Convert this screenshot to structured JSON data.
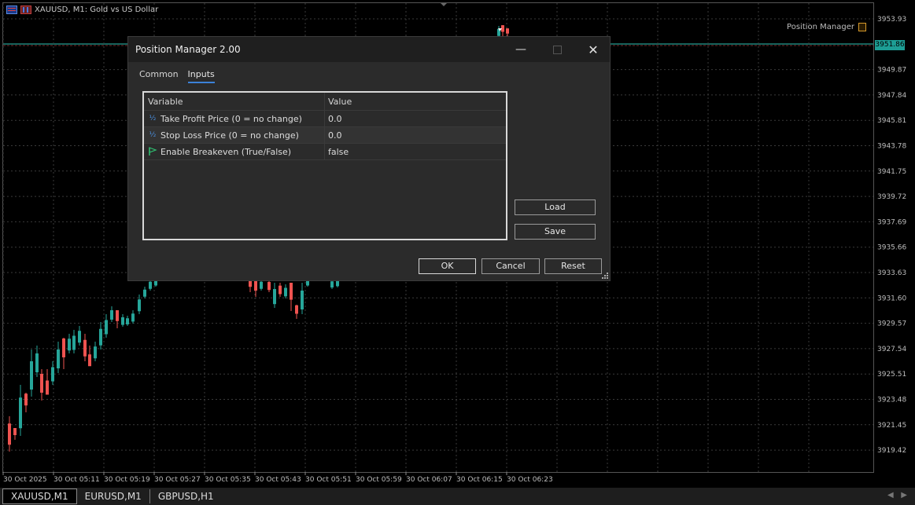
{
  "chart": {
    "title": "XAUUSD, M1:  Gold vs US Dollar",
    "ea_name": "Position Manager",
    "current_price": "3951.86",
    "price_labels": [
      "3953.93",
      "3951.86",
      "3949.87",
      "3947.84",
      "3945.81",
      "3943.78",
      "3941.75",
      "3939.72",
      "3937.69",
      "3935.66",
      "3933.63",
      "3931.60",
      "3929.57",
      "3927.54",
      "3925.51",
      "3923.48",
      "3921.45",
      "3919.42"
    ],
    "time_labels": [
      "30 Oct 2025",
      "30 Oct 05:11",
      "30 Oct 05:19",
      "30 Oct 05:27",
      "30 Oct 05:35",
      "30 Oct 05:43",
      "30 Oct 05:51",
      "30 Oct 05:59",
      "30 Oct 06:07",
      "30 Oct 06:15",
      "30 Oct 06:23"
    ],
    "colors": {
      "bull": "#26a69a",
      "bear": "#ef5350",
      "grid": "#3a3a3a",
      "bid_line": "#2ec4b6"
    }
  },
  "dialog": {
    "title": "Position Manager 2.00",
    "tabs": [
      {
        "label": "Common",
        "active": false
      },
      {
        "label": "Inputs",
        "active": true
      }
    ],
    "table": {
      "headers": [
        "Variable",
        "Value"
      ],
      "rows": [
        {
          "icon": "fraction-icon",
          "variable": "Take Profit Price (0 = no change)",
          "value": "0.0"
        },
        {
          "icon": "fraction-icon",
          "variable": "Stop Loss Price (0 = no change)",
          "value": "0.0"
        },
        {
          "icon": "flag-icon",
          "variable": "Enable Breakeven (True/False)",
          "value": "false"
        }
      ]
    },
    "buttons": {
      "load": "Load",
      "save": "Save",
      "ok": "OK",
      "cancel": "Cancel",
      "reset": "Reset"
    }
  },
  "symbol_tabs": [
    {
      "label": "XAUUSD,M1",
      "active": true
    },
    {
      "label": "EURUSD,M1",
      "active": false
    },
    {
      "label": "GBPUSD,H1",
      "active": false
    }
  ]
}
